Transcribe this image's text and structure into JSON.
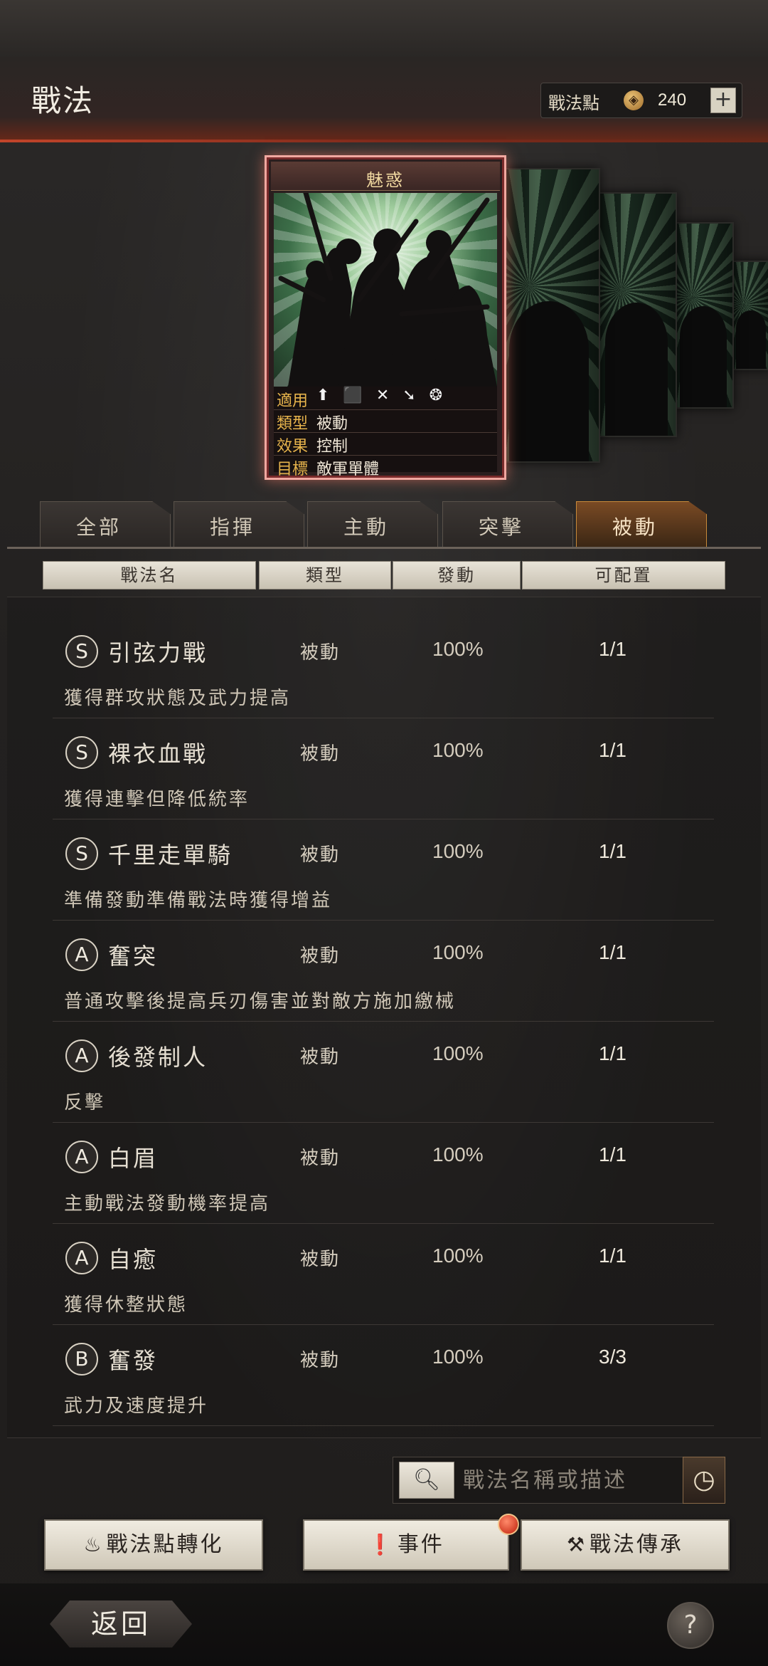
{
  "header": {
    "title": "戰法",
    "points_label": "戰法點",
    "points_icon": "coin-icon",
    "points_value": "240",
    "plus_label": "+"
  },
  "card": {
    "name": "魅惑",
    "icons": "⬆ ⬛ ✕ ➘ ❂",
    "rows": [
      {
        "label": "適用",
        "value": ""
      },
      {
        "label": "類型",
        "value": "被動"
      },
      {
        "label": "效果",
        "value": "控制"
      },
      {
        "label": "目標",
        "value": "敵軍單體"
      }
    ]
  },
  "tabs": [
    {
      "label": "全部"
    },
    {
      "label": "指揮"
    },
    {
      "label": "主動"
    },
    {
      "label": "突擊"
    },
    {
      "label": "被動",
      "active": true
    }
  ],
  "columns": [
    "戰法名",
    "類型",
    "發動",
    "可配置"
  ],
  "tactics": [
    {
      "grade": "S",
      "name": "引弦力戰",
      "type": "被動",
      "rate": "100%",
      "count": "1/1",
      "desc": "獲得群攻狀態及武力提高"
    },
    {
      "grade": "S",
      "name": "裸衣血戰",
      "type": "被動",
      "rate": "100%",
      "count": "1/1",
      "desc": "獲得連擊但降低統率"
    },
    {
      "grade": "S",
      "name": "千里走單騎",
      "type": "被動",
      "rate": "100%",
      "count": "1/1",
      "desc": "準備發動準備戰法時獲得增益"
    },
    {
      "grade": "A",
      "name": "奮突",
      "type": "被動",
      "rate": "100%",
      "count": "1/1",
      "desc": "普通攻擊後提高兵刃傷害並對敵方施加繳械"
    },
    {
      "grade": "A",
      "name": "後發制人",
      "type": "被動",
      "rate": "100%",
      "count": "1/1",
      "desc": "反擊"
    },
    {
      "grade": "A",
      "name": "白眉",
      "type": "被動",
      "rate": "100%",
      "count": "1/1",
      "desc": "主動戰法發動機率提高"
    },
    {
      "grade": "A",
      "name": "自癒",
      "type": "被動",
      "rate": "100%",
      "count": "1/1",
      "desc": "獲得休整狀態"
    },
    {
      "grade": "B",
      "name": "奮發",
      "type": "被動",
      "rate": "100%",
      "count": "3/3",
      "desc": "武力及速度提升"
    }
  ],
  "search": {
    "placeholder": "戰法名稱或描述"
  },
  "buttons": {
    "convert": "戰法點轉化",
    "events": "事件",
    "inherit": "戰法傳承"
  },
  "footer": {
    "back": "返回",
    "help": "?"
  }
}
